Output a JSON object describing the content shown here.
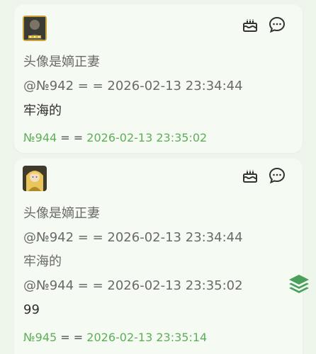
{
  "posts": [
    {
      "avatar_icon": "anime-avatar-dark-armored",
      "quote_lines": [
        "头像是嫡正妻",
        "@№942 = = 2026-02-13 23:34:44"
      ],
      "body_lines": [
        "牢海的"
      ],
      "footer": {
        "number": "№944",
        "separator": "= =",
        "timestamp": "2026-02-13 23:35:02"
      }
    },
    {
      "avatar_icon": "anime-avatar-blonde-girl",
      "quote_lines": [
        "头像是嫡正妻",
        "@№942 = = 2026-02-13 23:34:44",
        "牢海的",
        "@№944 = = 2026-02-13 23:35:02"
      ],
      "body_lines": [
        "99"
      ],
      "footer": {
        "number": "№945",
        "separator": "= =",
        "timestamp": "2026-02-13 23:35:14"
      }
    }
  ],
  "icons": {
    "gift": "cake-icon",
    "reply": "chat-bubble-icon",
    "floating": "layers-icon"
  },
  "colors": {
    "background": "#eef5ea",
    "card": "#f5faf2",
    "accent_green": "#5fae58",
    "quote_text": "#6a6a6a",
    "body_text": "#2e2e2e"
  }
}
